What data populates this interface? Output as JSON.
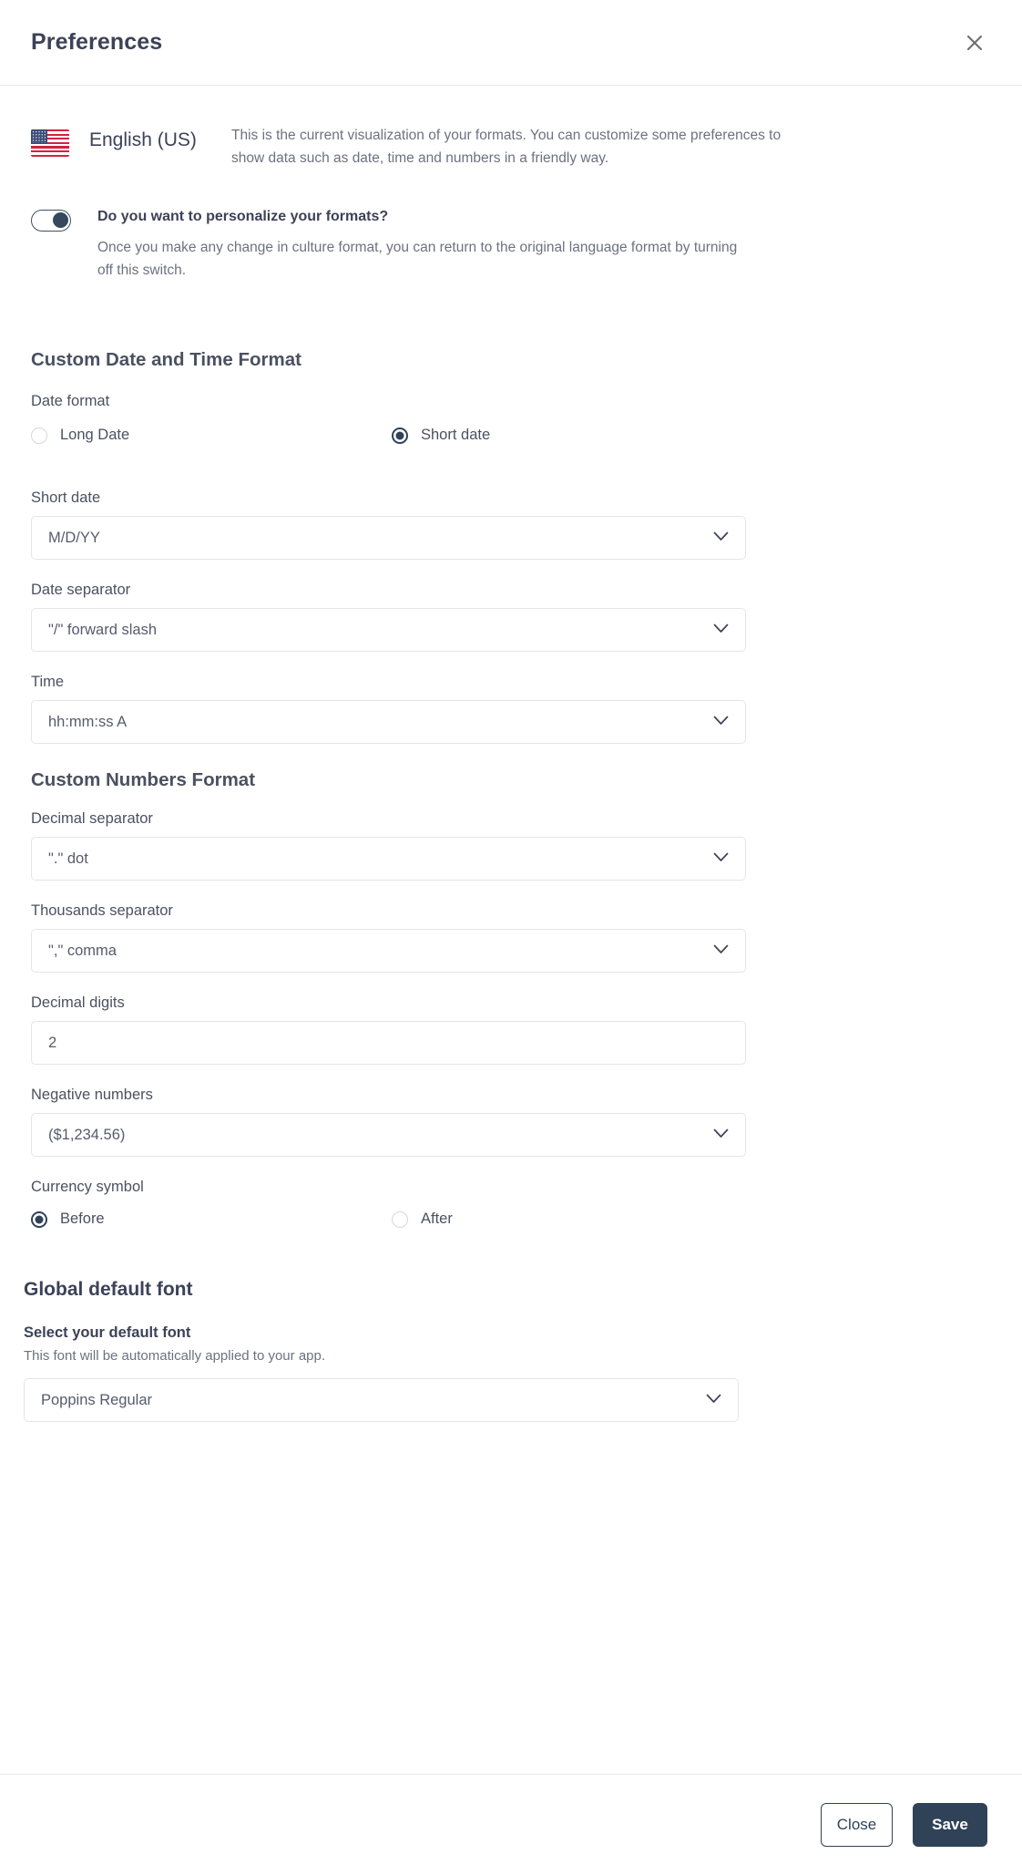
{
  "header": {
    "title": "Preferences",
    "close_icon": "close-icon"
  },
  "language": {
    "flag_icon": "us-flag-icon",
    "name": "English (US)",
    "description": "This is the current visualization of your formats. You can customize some preferences to show data such as date, time and numbers in a friendly way."
  },
  "personalize": {
    "toggle_state": "on",
    "label": "Do you want to personalize your formats?",
    "sub_label": "Once you make any change in culture format, you can return to the original language format by turning off this switch."
  },
  "date_section": {
    "title": "Custom Date and Time Format",
    "date_format_label": "Date format",
    "date_format_options": [
      {
        "label": "Long Date",
        "selected": false
      },
      {
        "label": "Short date",
        "selected": true
      }
    ],
    "short_date_label": "Short date",
    "short_date_value": "M/D/YY",
    "date_separator_label": "Date separator",
    "date_separator_value": "\"/\" forward slash",
    "time_label": "Time",
    "time_value": "hh:mm:ss A"
  },
  "numbers_section": {
    "title": "Custom Numbers Format",
    "decimal_separator_label": "Decimal separator",
    "decimal_separator_value": "\".\" dot",
    "thousands_separator_label": "Thousands separator",
    "thousands_separator_value": "\",\" comma",
    "decimal_digits_label": "Decimal digits",
    "decimal_digits_value": "2",
    "negative_numbers_label": "Negative numbers",
    "negative_numbers_value": "($1,234.56)",
    "currency_symbol_label": "Currency symbol",
    "currency_symbol_options": [
      {
        "label": "Before",
        "selected": true
      },
      {
        "label": "After",
        "selected": false
      }
    ]
  },
  "font_section": {
    "title": "Global default font",
    "sub_title": "Select your default font",
    "sub_desc": "This font will be automatically applied to your app.",
    "font_value": "Poppins Regular"
  },
  "footer": {
    "close_label": "Close",
    "save_label": "Save"
  },
  "colors": {
    "accent": "#2f4257",
    "text": "#3c4257",
    "muted": "#6b7280",
    "border": "#e3e5ea"
  }
}
